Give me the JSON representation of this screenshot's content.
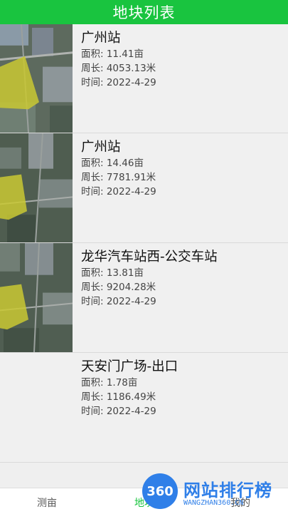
{
  "header": {
    "title": "地块列表"
  },
  "plots": [
    {
      "name": "广州站",
      "area": "面积: 11.41亩",
      "perimeter": "周长: 4053.13米",
      "time": "时间: 2022-4-29",
      "has_image": true
    },
    {
      "name": "广州站",
      "area": "面积: 14.46亩",
      "perimeter": "周长: 7781.91米",
      "time": "时间: 2022-4-29",
      "has_image": true
    },
    {
      "name": "龙华汽车站西-公交车站",
      "area": "面积: 13.81亩",
      "perimeter": "周长: 9204.28米",
      "time": "时间: 2022-4-29",
      "has_image": true
    },
    {
      "name": "天安门广场-出口",
      "area": "面积: 1.78亩",
      "perimeter": "周长: 1186.49米",
      "time": "时间: 2022-4-29",
      "has_image": false
    }
  ],
  "tabbar": {
    "tabs": [
      {
        "label": "测亩"
      },
      {
        "label": "地块"
      },
      {
        "label": "我的"
      }
    ],
    "active_color": "#19c43f"
  },
  "watermark": {
    "badge": "360",
    "text": "网站排行榜",
    "sub": "WANGZHAN360.CN"
  },
  "colors": {
    "accent": "#19c43f",
    "polygon_fill": "#c9c832"
  }
}
